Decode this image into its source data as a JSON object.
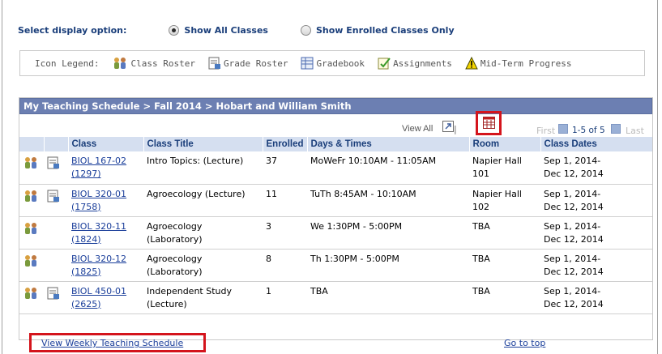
{
  "display_option": {
    "label": "Select display option:",
    "options": [
      {
        "label": "Show All Classes",
        "selected": true
      },
      {
        "label": "Show Enrolled Classes Only",
        "selected": false
      }
    ]
  },
  "legend": {
    "label": "Icon Legend:",
    "items": [
      {
        "icon": "class-roster-icon",
        "label": "Class Roster"
      },
      {
        "icon": "grade-roster-icon",
        "label": "Grade Roster"
      },
      {
        "icon": "gradebook-icon",
        "label": "Gradebook"
      },
      {
        "icon": "assignments-icon",
        "label": "Assignments"
      },
      {
        "icon": "mid-term-progress-icon",
        "label": "Mid-Term Progress"
      }
    ]
  },
  "header": {
    "title": "My Teaching Schedule > Fall 2014 > Hobart and William Smith"
  },
  "nav": {
    "view_all": "View All",
    "separator": "|",
    "first": "First",
    "range": "1-5 of 5",
    "last": "Last"
  },
  "table": {
    "columns": [
      "Class",
      "Class Title",
      "Enrolled",
      "Days & Times",
      "Room",
      "Class Dates"
    ],
    "rows": [
      {
        "class": "BIOL 167-02",
        "class_nbr": "(1297)",
        "title_1": "Intro Topics: (Lecture)",
        "title_2": "",
        "enrolled": "37",
        "days_times": "MoWeFr 10:10AM - 11:05AM",
        "room_1": "Napier Hall",
        "room_2": "101",
        "dates_1": "Sep 1, 2014-",
        "dates_2": "Dec 12, 2014",
        "grade_roster": true
      },
      {
        "class": "BIOL 320-01",
        "class_nbr": "(1758)",
        "title_1": "Agroecology (Lecture)",
        "title_2": "",
        "enrolled": "11",
        "days_times": "TuTh 8:45AM - 10:10AM",
        "room_1": "Napier Hall",
        "room_2": "102",
        "dates_1": "Sep 1, 2014-",
        "dates_2": "Dec 12, 2014",
        "grade_roster": true
      },
      {
        "class": "BIOL 320-11",
        "class_nbr": "(1824)",
        "title_1": "Agroecology",
        "title_2": "(Laboratory)",
        "enrolled": "3",
        "days_times": "We 1:30PM - 5:00PM",
        "room_1": "TBA",
        "room_2": "",
        "dates_1": "Sep 1, 2014-",
        "dates_2": "Dec 12, 2014",
        "grade_roster": false
      },
      {
        "class": "BIOL 320-12",
        "class_nbr": "(1825)",
        "title_1": "Agroecology",
        "title_2": "(Laboratory)",
        "enrolled": "8",
        "days_times": "Th 1:30PM - 5:00PM",
        "room_1": "TBA",
        "room_2": "",
        "dates_1": "Sep 1, 2014-",
        "dates_2": "Dec 12, 2014",
        "grade_roster": false
      },
      {
        "class": "BIOL 450-01",
        "class_nbr": "(2625)",
        "title_1": "Independent Study",
        "title_2": "(Lecture)",
        "enrolled": "1",
        "days_times": "TBA",
        "room_1": "TBA",
        "room_2": "",
        "dates_1": "Sep 1, 2014-",
        "dates_2": "Dec 12, 2014",
        "grade_roster": true
      }
    ]
  },
  "links": {
    "weekly": "View Weekly Teaching Schedule",
    "go_to_top": "Go to top"
  },
  "colors": {
    "header_bg": "#6c7fb2",
    "column_header_bg": "#d5dff0",
    "link": "#1a3e9a",
    "highlight_box": "#d4141c"
  }
}
